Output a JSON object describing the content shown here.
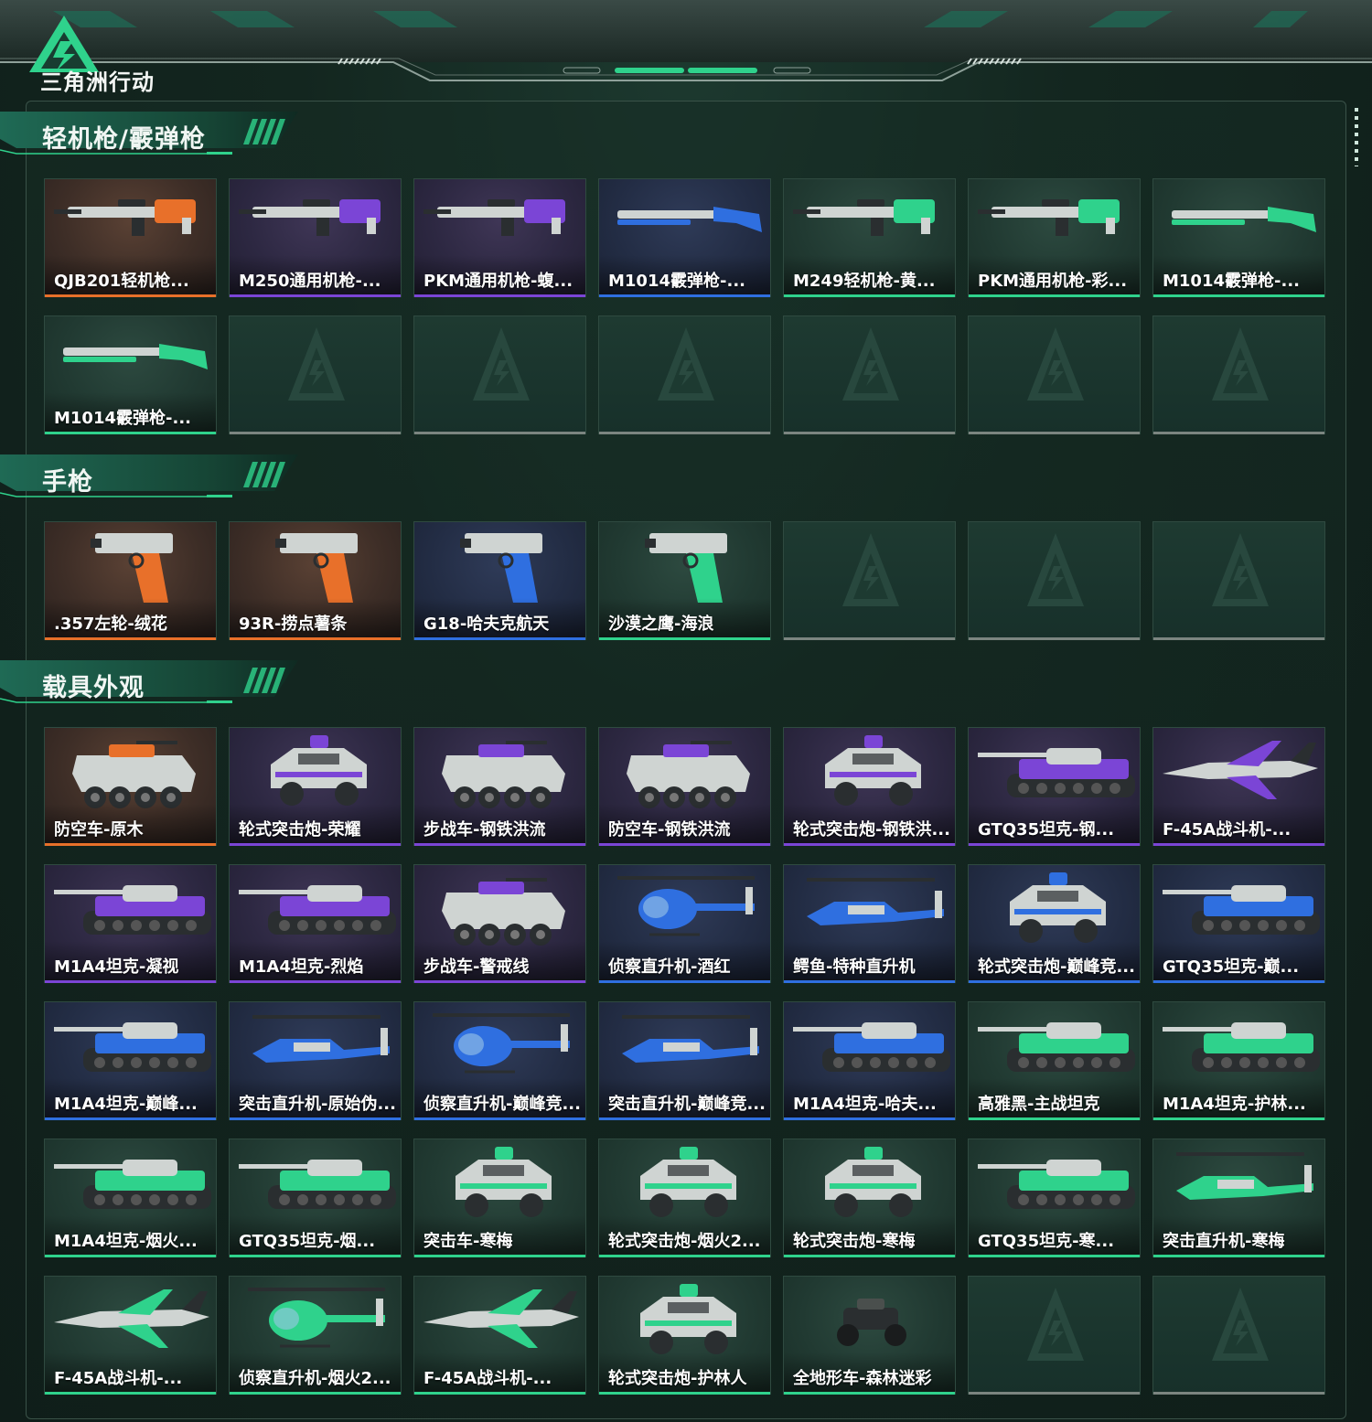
{
  "header": {
    "brand_text": "三角洲行动",
    "logo_glyph": "triangle-lightning-logo"
  },
  "colors": {
    "orange": "#e8702a",
    "purple": "#7b45d6",
    "blue": "#2f6fe0",
    "green": "#2fd28c",
    "empty": "#7b8580"
  },
  "sections": [
    {
      "title": "轻机枪/霰弹枪",
      "items": [
        {
          "label": "QJB201轻机枪...",
          "rarity": "orange",
          "icon": "lmg-icon"
        },
        {
          "label": "M250通用机枪-...",
          "rarity": "purple",
          "icon": "machine-gun-icon"
        },
        {
          "label": "PKM通用机枪-蝮...",
          "rarity": "purple",
          "icon": "machine-gun-icon"
        },
        {
          "label": "M1014霰弹枪-...",
          "rarity": "blue",
          "icon": "shotgun-icon"
        },
        {
          "label": "M249轻机枪-黄...",
          "rarity": "green",
          "icon": "lmg-icon"
        },
        {
          "label": "PKM通用机枪-彩...",
          "rarity": "green",
          "icon": "machine-gun-icon"
        },
        {
          "label": "M1014霰弹枪-...",
          "rarity": "green",
          "icon": "shotgun-icon"
        },
        {
          "label": "M1014霰弹枪-...",
          "rarity": "green",
          "icon": "shotgun-icon"
        },
        {
          "label": "",
          "rarity": "empty"
        },
        {
          "label": "",
          "rarity": "empty"
        },
        {
          "label": "",
          "rarity": "empty"
        },
        {
          "label": "",
          "rarity": "empty"
        },
        {
          "label": "",
          "rarity": "empty"
        },
        {
          "label": "",
          "rarity": "empty"
        }
      ]
    },
    {
      "title": "手枪",
      "items": [
        {
          "label": ".357左轮-绒花",
          "rarity": "orange",
          "icon": "revolver-icon"
        },
        {
          "label": "93R-捞点薯条",
          "rarity": "orange",
          "icon": "pistol-icon"
        },
        {
          "label": "G18-哈夫克航天",
          "rarity": "blue",
          "icon": "pistol-icon"
        },
        {
          "label": "沙漠之鹰-海浪",
          "rarity": "green",
          "icon": "pistol-icon"
        },
        {
          "label": "",
          "rarity": "empty"
        },
        {
          "label": "",
          "rarity": "empty"
        },
        {
          "label": "",
          "rarity": "empty"
        }
      ]
    },
    {
      "title": "载具外观",
      "items": [
        {
          "label": "防空车-原木",
          "rarity": "orange",
          "icon": "armored-vehicle-icon"
        },
        {
          "label": "轮式突击炮-荣耀",
          "rarity": "purple",
          "icon": "assault-car-icon"
        },
        {
          "label": "步战车-钢铁洪流",
          "rarity": "purple",
          "icon": "armored-vehicle-icon"
        },
        {
          "label": "防空车-钢铁洪流",
          "rarity": "purple",
          "icon": "armored-vehicle-icon"
        },
        {
          "label": "轮式突击炮-钢铁洪...",
          "rarity": "purple",
          "icon": "assault-car-icon"
        },
        {
          "label": "GTQ35坦克-钢...",
          "rarity": "purple",
          "icon": "tank-icon"
        },
        {
          "label": "F-45A战斗机-...",
          "rarity": "purple",
          "icon": "jet-icon"
        },
        {
          "label": "M1A4坦克-凝视",
          "rarity": "purple",
          "icon": "tank-icon"
        },
        {
          "label": "M1A4坦克-烈焰",
          "rarity": "purple",
          "icon": "tank-icon"
        },
        {
          "label": "步战车-警戒线",
          "rarity": "purple",
          "icon": "armored-vehicle-icon"
        },
        {
          "label": "侦察直升机-酒红",
          "rarity": "blue",
          "icon": "helicopter-icon"
        },
        {
          "label": "鳄鱼-特种直升机",
          "rarity": "blue",
          "icon": "attack-helicopter-icon"
        },
        {
          "label": "轮式突击炮-巅峰竞...",
          "rarity": "blue",
          "icon": "assault-car-icon"
        },
        {
          "label": "GTQ35坦克-巅...",
          "rarity": "blue",
          "icon": "tank-icon"
        },
        {
          "label": "M1A4坦克-巅峰...",
          "rarity": "blue",
          "icon": "tank-icon"
        },
        {
          "label": "突击直升机-原始伪...",
          "rarity": "blue",
          "icon": "attack-helicopter-icon"
        },
        {
          "label": "侦察直升机-巅峰竞...",
          "rarity": "blue",
          "icon": "helicopter-icon"
        },
        {
          "label": "突击直升机-巅峰竞...",
          "rarity": "blue",
          "icon": "attack-helicopter-icon"
        },
        {
          "label": "M1A4坦克-哈夫...",
          "rarity": "blue",
          "icon": "tank-icon"
        },
        {
          "label": "高雅黑-主战坦克",
          "rarity": "green",
          "icon": "tank-icon"
        },
        {
          "label": "M1A4坦克-护林...",
          "rarity": "green",
          "icon": "tank-icon"
        },
        {
          "label": "M1A4坦克-烟火...",
          "rarity": "green",
          "icon": "tank-icon"
        },
        {
          "label": "GTQ35坦克-烟...",
          "rarity": "green",
          "icon": "tank-icon"
        },
        {
          "label": "突击车-寒梅",
          "rarity": "green",
          "icon": "assault-car-icon"
        },
        {
          "label": "轮式突击炮-烟火2...",
          "rarity": "green",
          "icon": "assault-car-icon"
        },
        {
          "label": "轮式突击炮-寒梅",
          "rarity": "green",
          "icon": "assault-car-icon"
        },
        {
          "label": "GTQ35坦克-寒...",
          "rarity": "green",
          "icon": "tank-icon"
        },
        {
          "label": "突击直升机-寒梅",
          "rarity": "green",
          "icon": "attack-helicopter-icon"
        },
        {
          "label": "F-45A战斗机-...",
          "rarity": "green",
          "icon": "jet-icon"
        },
        {
          "label": "侦察直升机-烟火2...",
          "rarity": "green",
          "icon": "helicopter-icon"
        },
        {
          "label": "F-45A战斗机-...",
          "rarity": "green",
          "icon": "jet-icon"
        },
        {
          "label": "轮式突击炮-护林人",
          "rarity": "green",
          "icon": "assault-car-icon"
        },
        {
          "label": "全地形车-森林迷彩",
          "rarity": "green",
          "icon": "atv-icon"
        },
        {
          "label": "",
          "rarity": "empty"
        },
        {
          "label": "",
          "rarity": "empty"
        }
      ]
    }
  ]
}
